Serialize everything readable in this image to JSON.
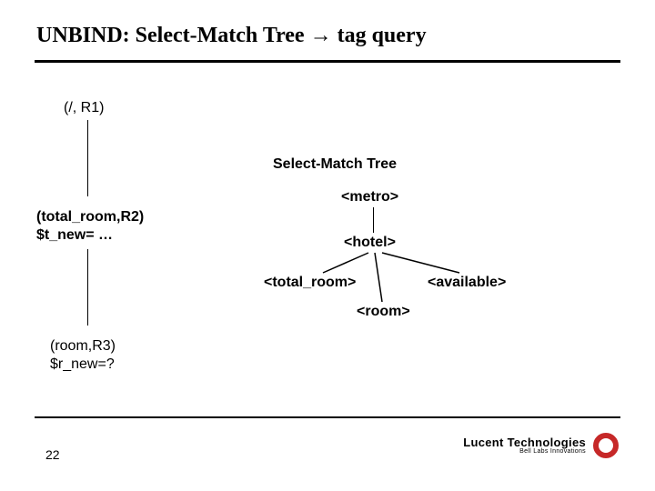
{
  "title": "UNBIND: Select-Match Tree → tag query",
  "left_tree": {
    "n1": "(/, R1)",
    "n2_line1": "(total_room,R2)",
    "n2_line2": "$t_new= …",
    "n3_line1": "(room,R3)",
    "n3_line2": "$r_new=?"
  },
  "right_tree": {
    "heading": "Select-Match Tree",
    "metro": "<metro>",
    "hotel": "<hotel>",
    "total_room": "<total_room>",
    "available": "<available>",
    "room": "<room>"
  },
  "footer": {
    "page": "22",
    "logo_main": "Lucent Technologies",
    "logo_sub": "Bell Labs Innovations"
  }
}
